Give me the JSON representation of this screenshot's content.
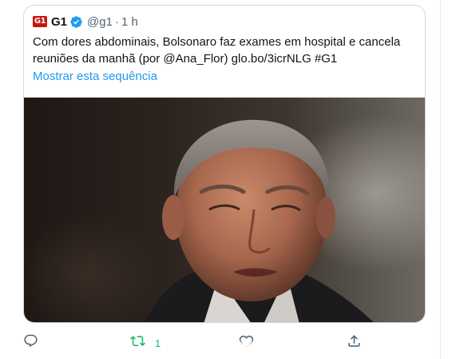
{
  "tweet": {
    "author_name": "G1",
    "logo_text": "G1",
    "handle": "@g1",
    "separator": "·",
    "time": "1 h",
    "text": "Com dores abdominais, Bolsonaro faz exames em hospital e cancela reuniões da manhã (por @Ana_Flor) glo.bo/3icrNLG #G1",
    "thread_link": "Mostrar esta sequência",
    "retweet_count": "1"
  },
  "colors": {
    "brand_red": "#c4170c",
    "link_blue": "#1d9bf0",
    "retweet_green": "#17bf63",
    "icon_gray": "#536471"
  },
  "icons": {
    "verified": "verified-badge-icon",
    "reply": "reply-icon",
    "retweet": "retweet-icon",
    "like": "heart-icon",
    "share": "share-icon"
  }
}
